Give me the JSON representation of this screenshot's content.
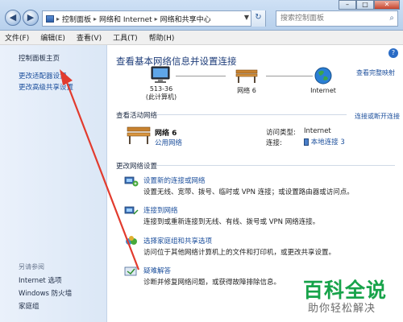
{
  "address_bar": {
    "crumbs": [
      "控制面板",
      "网络和 Internet",
      "网络和共享中心"
    ],
    "search_placeholder": "搜索控制面板"
  },
  "menu": [
    "文件(F)",
    "编辑(E)",
    "查看(V)",
    "工具(T)",
    "帮助(H)"
  ],
  "left_pane": {
    "home": "控制面板主页",
    "links": [
      "更改适配器设置",
      "更改高级共享设置"
    ],
    "see_also_title": "另请参阅",
    "see_also": [
      "Internet 选项",
      "Windows 防火墙",
      "家庭组"
    ]
  },
  "main": {
    "title": "查看基本网络信息并设置连接",
    "full_map": "查看完整映射",
    "map": {
      "computer_name": "513-36",
      "computer_caption": "(此计算机)",
      "network_name": "网络  6",
      "internet": "Internet"
    },
    "active_networks_title": "查看活动网络",
    "connect_disconnect": "连接或断开连接",
    "active_network": {
      "name": "网络  6",
      "type": "公用网络",
      "access_type_label": "访问类型:",
      "access_type_value": "Internet",
      "connections_label": "连接:",
      "connections_value": "本地连接 3"
    },
    "change_settings_title": "更改网络设置",
    "tasks": [
      {
        "title": "设置新的连接或网络",
        "desc": "设置无线、宽带、拨号、临时或 VPN 连接；或设置路由器或访问点。"
      },
      {
        "title": "连接到网络",
        "desc": "连接到或重新连接到无线、有线、拨号或 VPN 网络连接。"
      },
      {
        "title": "选择家庭组和共享选项",
        "desc": "访问位于其他网络计算机上的文件和打印机，或更改共享设置。"
      },
      {
        "title": "疑难解答",
        "desc": "诊断并修复网络问题，或获得故障排除信息。"
      }
    ]
  },
  "watermark": {
    "brand": "百科全说",
    "slogan": "助你轻松解决"
  },
  "colors": {
    "link": "#1c4f9c",
    "arrow": "#e23b2e",
    "watermark": "#17a34a"
  }
}
